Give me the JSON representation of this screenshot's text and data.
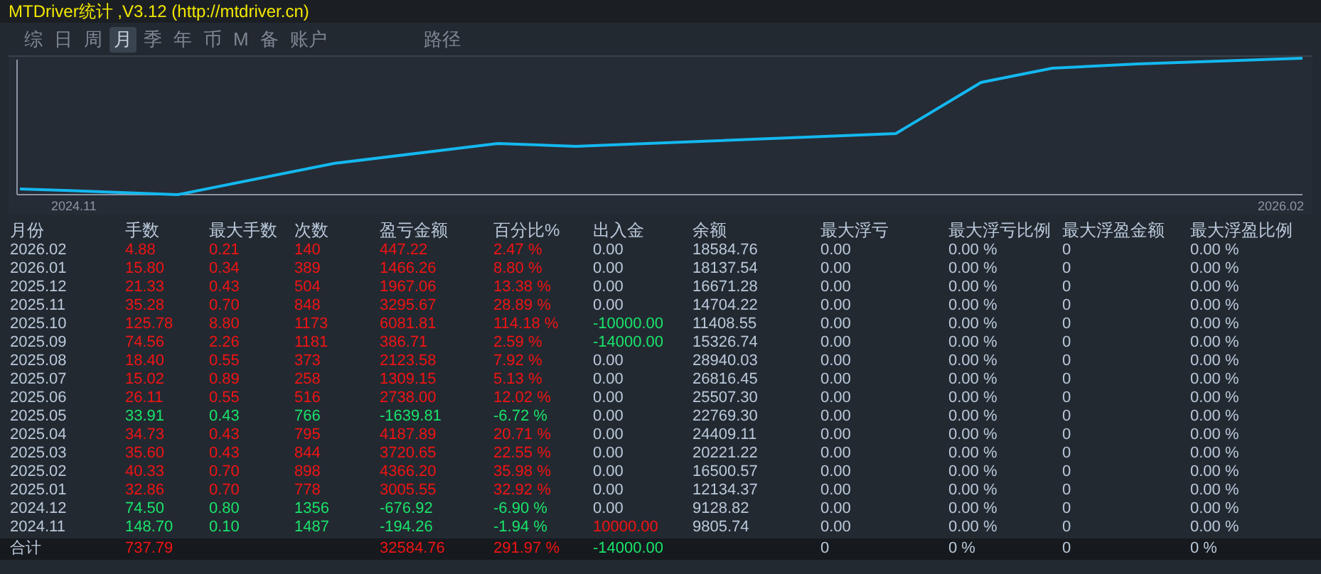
{
  "window": {
    "title": "MTDriver统计 ,V3.12 (http://mtdriver.cn)"
  },
  "tabs": [
    {
      "label": "综",
      "selected": false
    },
    {
      "label": "日",
      "selected": false
    },
    {
      "label": "周",
      "selected": false
    },
    {
      "label": "月",
      "selected": true
    },
    {
      "label": "季",
      "selected": false
    },
    {
      "label": "年",
      "selected": false
    },
    {
      "label": "币",
      "selected": false
    },
    {
      "label": "M",
      "selected": false
    },
    {
      "label": "备",
      "selected": false
    },
    {
      "label": "账户",
      "selected": false
    },
    {
      "label": "路径",
      "selected": false
    }
  ],
  "chart": {
    "x_start": "2024.11",
    "x_end": "2026.02"
  },
  "table": {
    "columns": [
      "月份",
      "手数",
      "最大手数",
      "次数",
      "盈亏金额",
      "百分比%",
      "出入金",
      "余额",
      "最大浮亏",
      "最大浮亏比例",
      "最大浮盈金额",
      "最大浮盈比例"
    ],
    "rows": [
      {
        "color": "#f01414",
        "cells": [
          "2026.02",
          "4.88",
          "0.21",
          "140",
          "447.22",
          "2.47 %",
          {
            "text": "0.00",
            "color": "#b9c8da"
          },
          "18584.76",
          "0.00",
          "0.00 %",
          "0",
          "0.00 %"
        ]
      },
      {
        "color": "#f01414",
        "cells": [
          "2026.01",
          "15.80",
          "0.34",
          "389",
          "1466.26",
          "8.80 %",
          {
            "text": "0.00",
            "color": "#b9c8da"
          },
          "18137.54",
          "0.00",
          "0.00 %",
          "0",
          "0.00 %"
        ]
      },
      {
        "color": "#f01414",
        "cells": [
          "2025.12",
          "21.33",
          "0.43",
          "504",
          "1967.06",
          "13.38 %",
          {
            "text": "0.00",
            "color": "#b9c8da"
          },
          "16671.28",
          "0.00",
          "0.00 %",
          "0",
          "0.00 %"
        ]
      },
      {
        "color": "#f01414",
        "cells": [
          "2025.11",
          "35.28",
          "0.70",
          "848",
          "3295.67",
          "28.89 %",
          {
            "text": "0.00",
            "color": "#b9c8da"
          },
          "14704.22",
          "0.00",
          "0.00 %",
          "0",
          "0.00 %"
        ]
      },
      {
        "color": "#f01414",
        "cells": [
          "2025.10",
          "125.78",
          "8.80",
          "1173",
          "6081.81",
          "114.18 %",
          {
            "text": "-10000.00",
            "color": "#19e36a"
          },
          "11408.55",
          "0.00",
          "0.00 %",
          "0",
          "0.00 %"
        ]
      },
      {
        "color": "#f01414",
        "cells": [
          "2025.09",
          "74.56",
          "2.26",
          "1181",
          "386.71",
          "2.59 %",
          {
            "text": "-14000.00",
            "color": "#19e36a"
          },
          "15326.74",
          "0.00",
          "0.00 %",
          "0",
          "0.00 %"
        ]
      },
      {
        "color": "#f01414",
        "cells": [
          "2025.08",
          "18.40",
          "0.55",
          "373",
          "2123.58",
          "7.92 %",
          {
            "text": "0.00",
            "color": "#b9c8da"
          },
          "28940.03",
          "0.00",
          "0.00 %",
          "0",
          "0.00 %"
        ]
      },
      {
        "color": "#f01414",
        "cells": [
          "2025.07",
          "15.02",
          "0.89",
          "258",
          "1309.15",
          "5.13 %",
          {
            "text": "0.00",
            "color": "#b9c8da"
          },
          "26816.45",
          "0.00",
          "0.00 %",
          "0",
          "0.00 %"
        ]
      },
      {
        "color": "#f01414",
        "cells": [
          "2025.06",
          "26.11",
          "0.55",
          "516",
          "2738.00",
          "12.02 %",
          {
            "text": "0.00",
            "color": "#b9c8da"
          },
          "25507.30",
          "0.00",
          "0.00 %",
          "0",
          "0.00 %"
        ]
      },
      {
        "color": "#19e36a",
        "cells": [
          "2025.05",
          "33.91",
          "0.43",
          "766",
          "-1639.81",
          "-6.72 %",
          {
            "text": "0.00",
            "color": "#b9c8da"
          },
          "22769.30",
          "0.00",
          "0.00 %",
          "0",
          "0.00 %"
        ]
      },
      {
        "color": "#f01414",
        "cells": [
          "2025.04",
          "34.73",
          "0.43",
          "795",
          "4187.89",
          "20.71 %",
          {
            "text": "0.00",
            "color": "#b9c8da"
          },
          "24409.11",
          "0.00",
          "0.00 %",
          "0",
          "0.00 %"
        ]
      },
      {
        "color": "#f01414",
        "cells": [
          "2025.03",
          "35.60",
          "0.43",
          "844",
          "3720.65",
          "22.55 %",
          {
            "text": "0.00",
            "color": "#b9c8da"
          },
          "20221.22",
          "0.00",
          "0.00 %",
          "0",
          "0.00 %"
        ]
      },
      {
        "color": "#f01414",
        "cells": [
          "2025.02",
          "40.33",
          "0.70",
          "898",
          "4366.20",
          "35.98 %",
          {
            "text": "0.00",
            "color": "#b9c8da"
          },
          "16500.57",
          "0.00",
          "0.00 %",
          "0",
          "0.00 %"
        ]
      },
      {
        "color": "#f01414",
        "cells": [
          "2025.01",
          "32.86",
          "0.70",
          "778",
          "3005.55",
          "32.92 %",
          {
            "text": "0.00",
            "color": "#b9c8da"
          },
          "12134.37",
          "0.00",
          "0.00 %",
          "0",
          "0.00 %"
        ]
      },
      {
        "color": "#19e36a",
        "cells": [
          "2024.12",
          "74.50",
          "0.80",
          "1356",
          "-676.92",
          "-6.90 %",
          {
            "text": "0.00",
            "color": "#b9c8da"
          },
          "9128.82",
          "0.00",
          "0.00 %",
          "0",
          "0.00 %"
        ]
      },
      {
        "color": "#19e36a",
        "cells": [
          "2024.11",
          "148.70",
          "0.10",
          "1487",
          "-194.26",
          "-1.94 %",
          {
            "text": "10000.00",
            "color": "#f01414"
          },
          "9805.74",
          "0.00",
          "0.00 %",
          "0",
          "0.00 %"
        ]
      }
    ],
    "total": {
      "color": "#f01414",
      "cells": [
        "合计",
        "737.79",
        "",
        "",
        "32584.76",
        "291.97 %",
        {
          "text": "-14000.00",
          "color": "#19e36a"
        },
        "",
        "0",
        "0 %",
        "0",
        "0 %"
      ]
    }
  }
}
